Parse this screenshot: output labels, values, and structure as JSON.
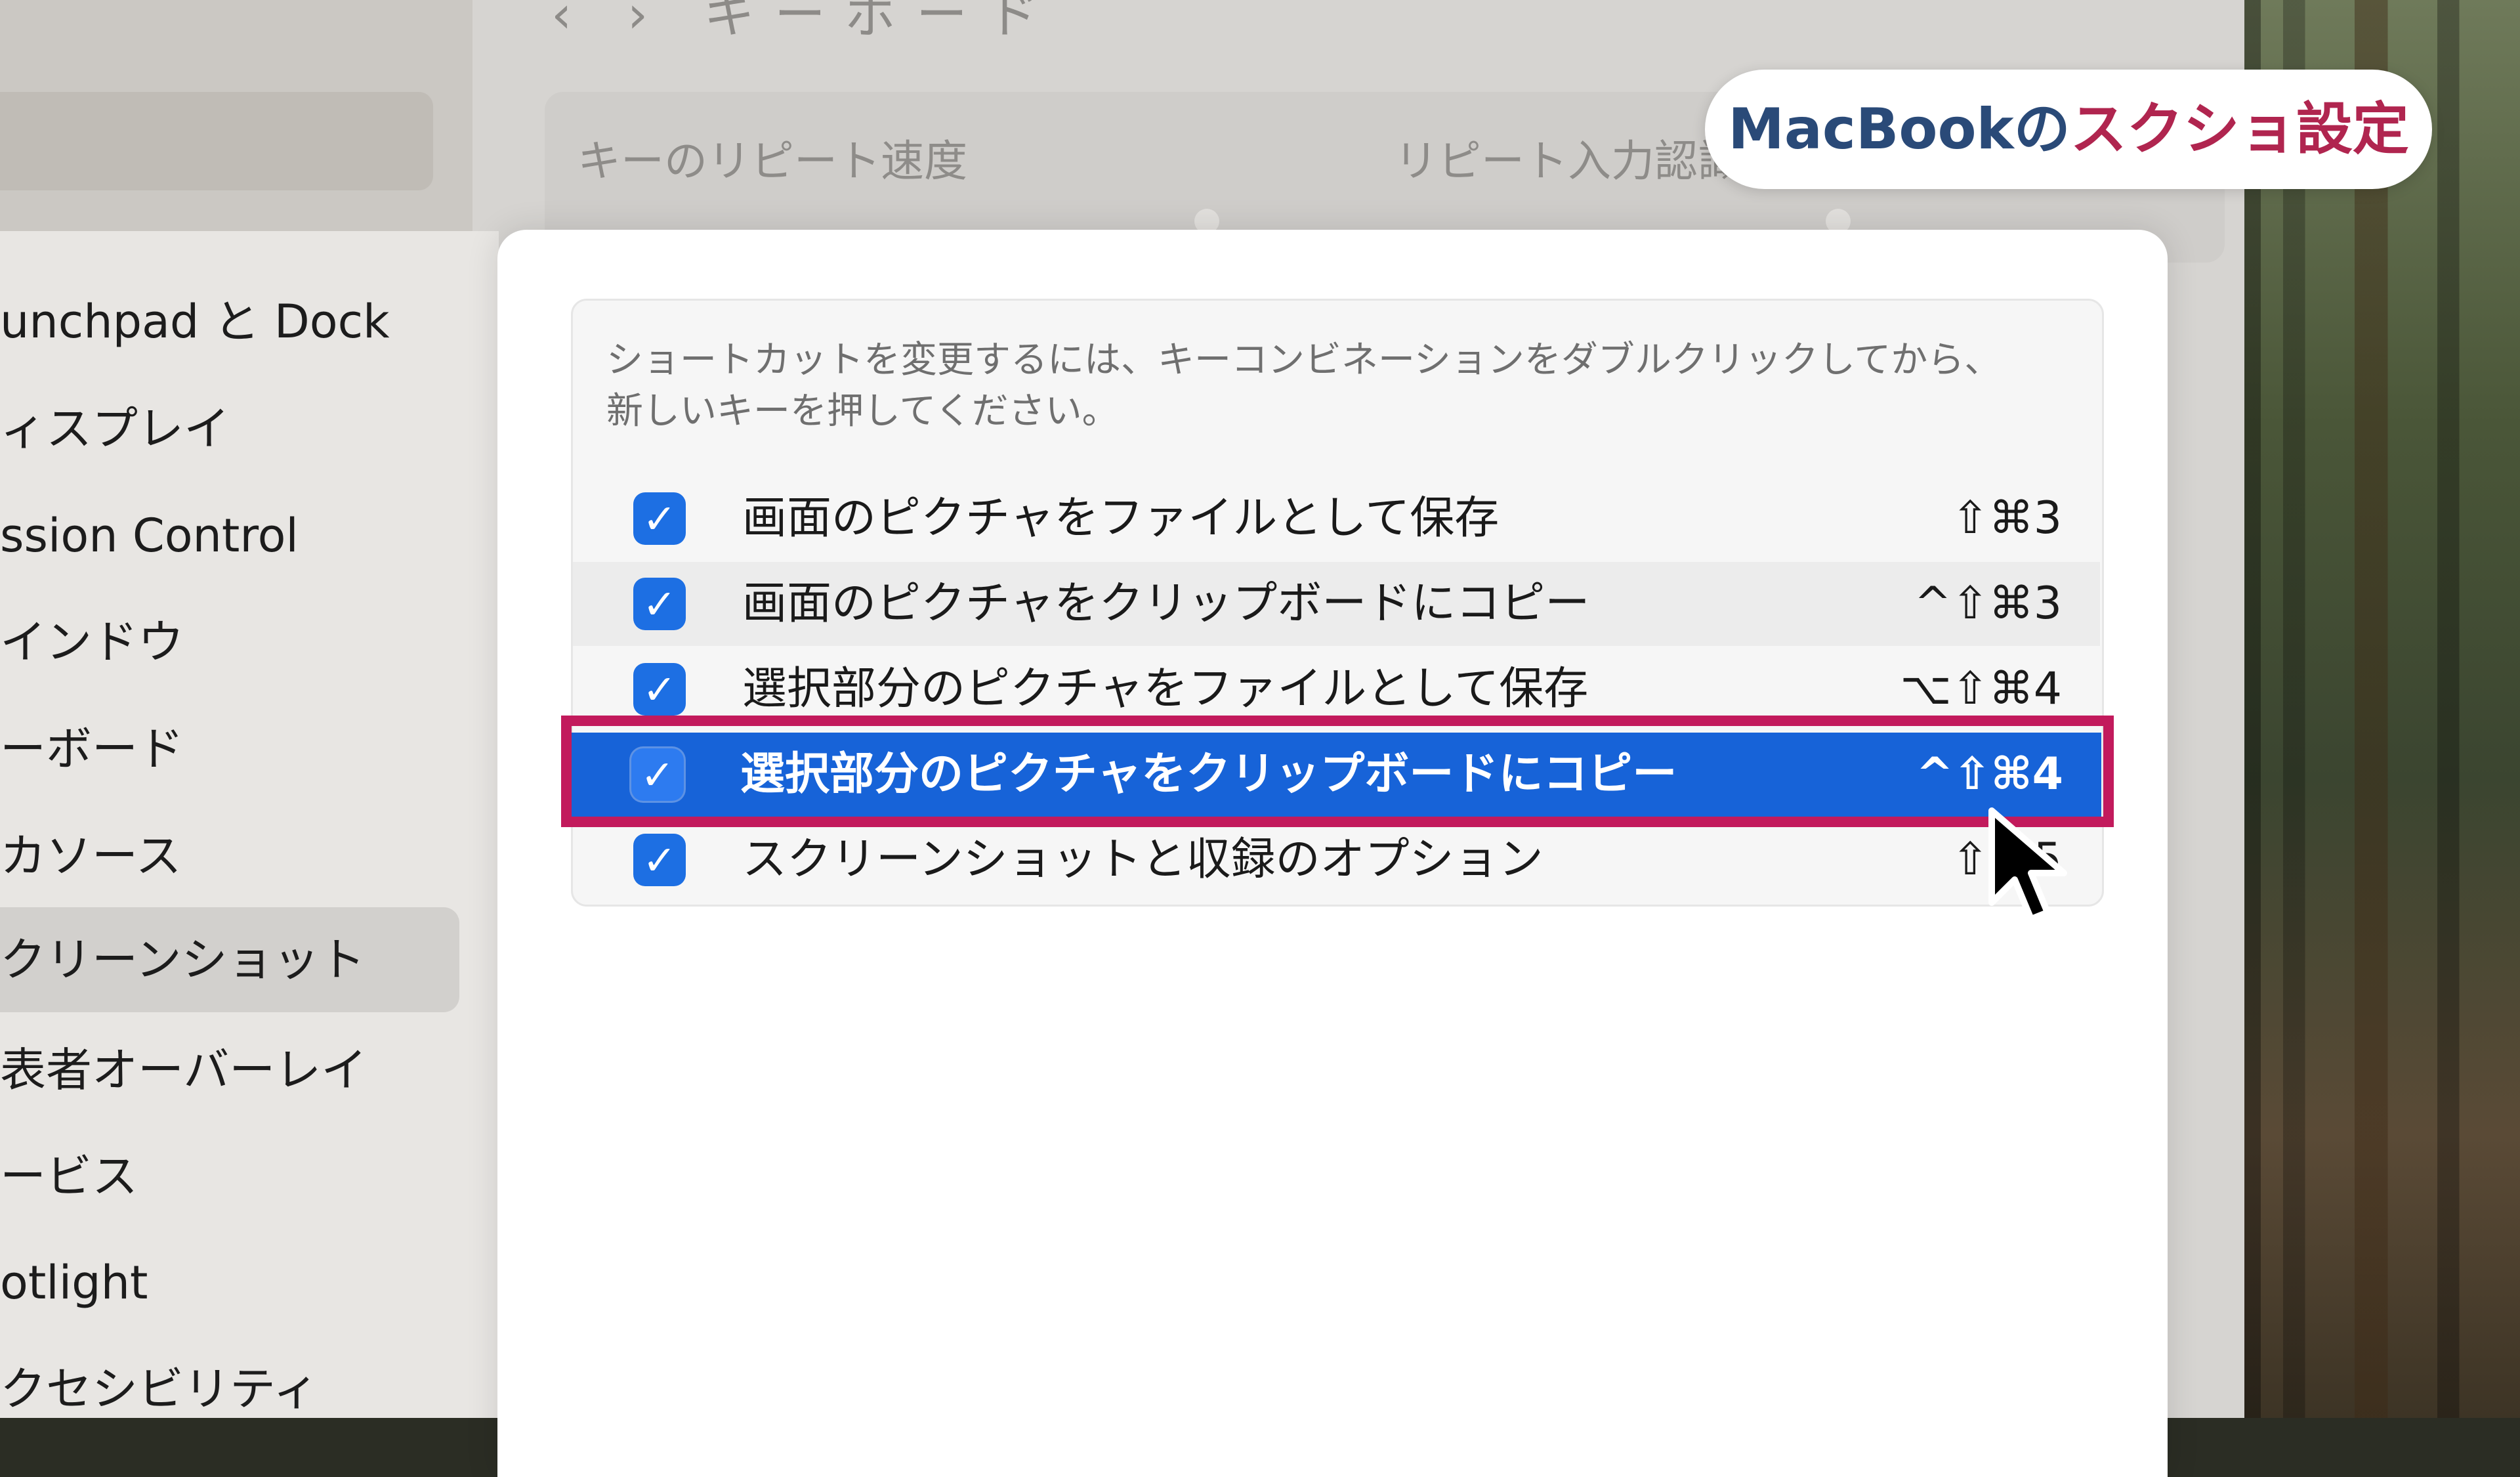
{
  "background": {
    "nav_arrows": "‹  ›",
    "nav_title": "キーボード",
    "labels": [
      "キーのリピート速度",
      "リピート入力認識"
    ]
  },
  "badge": {
    "part_a": "MacBookの",
    "part_b": "スクショ設定"
  },
  "sidebar": {
    "items": [
      {
        "label": "unchpad と Dock"
      },
      {
        "label": "ィスプレイ"
      },
      {
        "label": "ssion Control"
      },
      {
        "label": "インドウ"
      },
      {
        "label": "ーボード"
      },
      {
        "label": "カソース"
      },
      {
        "label": "クリーンショット"
      },
      {
        "label": "表者オーバーレイ"
      },
      {
        "label": "ービス"
      },
      {
        "label": "otlight"
      },
      {
        "label": "クセシビリティ"
      }
    ],
    "active_index": 6
  },
  "description": {
    "line1": "ショートカットを変更するには、キーコンビネーションをダブルクリックしてから、",
    "line2": "新しいキーを押してください。"
  },
  "shortcuts": [
    {
      "checked": true,
      "label": "画面のピクチャをファイルとして保存",
      "keys": "⇧⌘3"
    },
    {
      "checked": true,
      "label": "画面のピクチャをクリップボードにコピー",
      "keys": "^⇧⌘3"
    },
    {
      "checked": true,
      "label": "選択部分のピクチャをファイルとして保存",
      "keys": "⌥⇧⌘4"
    },
    {
      "checked": true,
      "label": "選択部分のピクチャをクリップボードにコピー",
      "keys": "^⇧⌘4"
    },
    {
      "checked": true,
      "label": "スクリーンショットと収録のオプション",
      "keys": "⇧⌘5"
    }
  ],
  "checkmark": "✓",
  "colors": {
    "selection": "#1763d8",
    "checkbox": "#1d6fe3",
    "highlight_border": "#c21a5c",
    "badge_primary": "#2a4a78",
    "badge_accent": "#b0254f"
  }
}
